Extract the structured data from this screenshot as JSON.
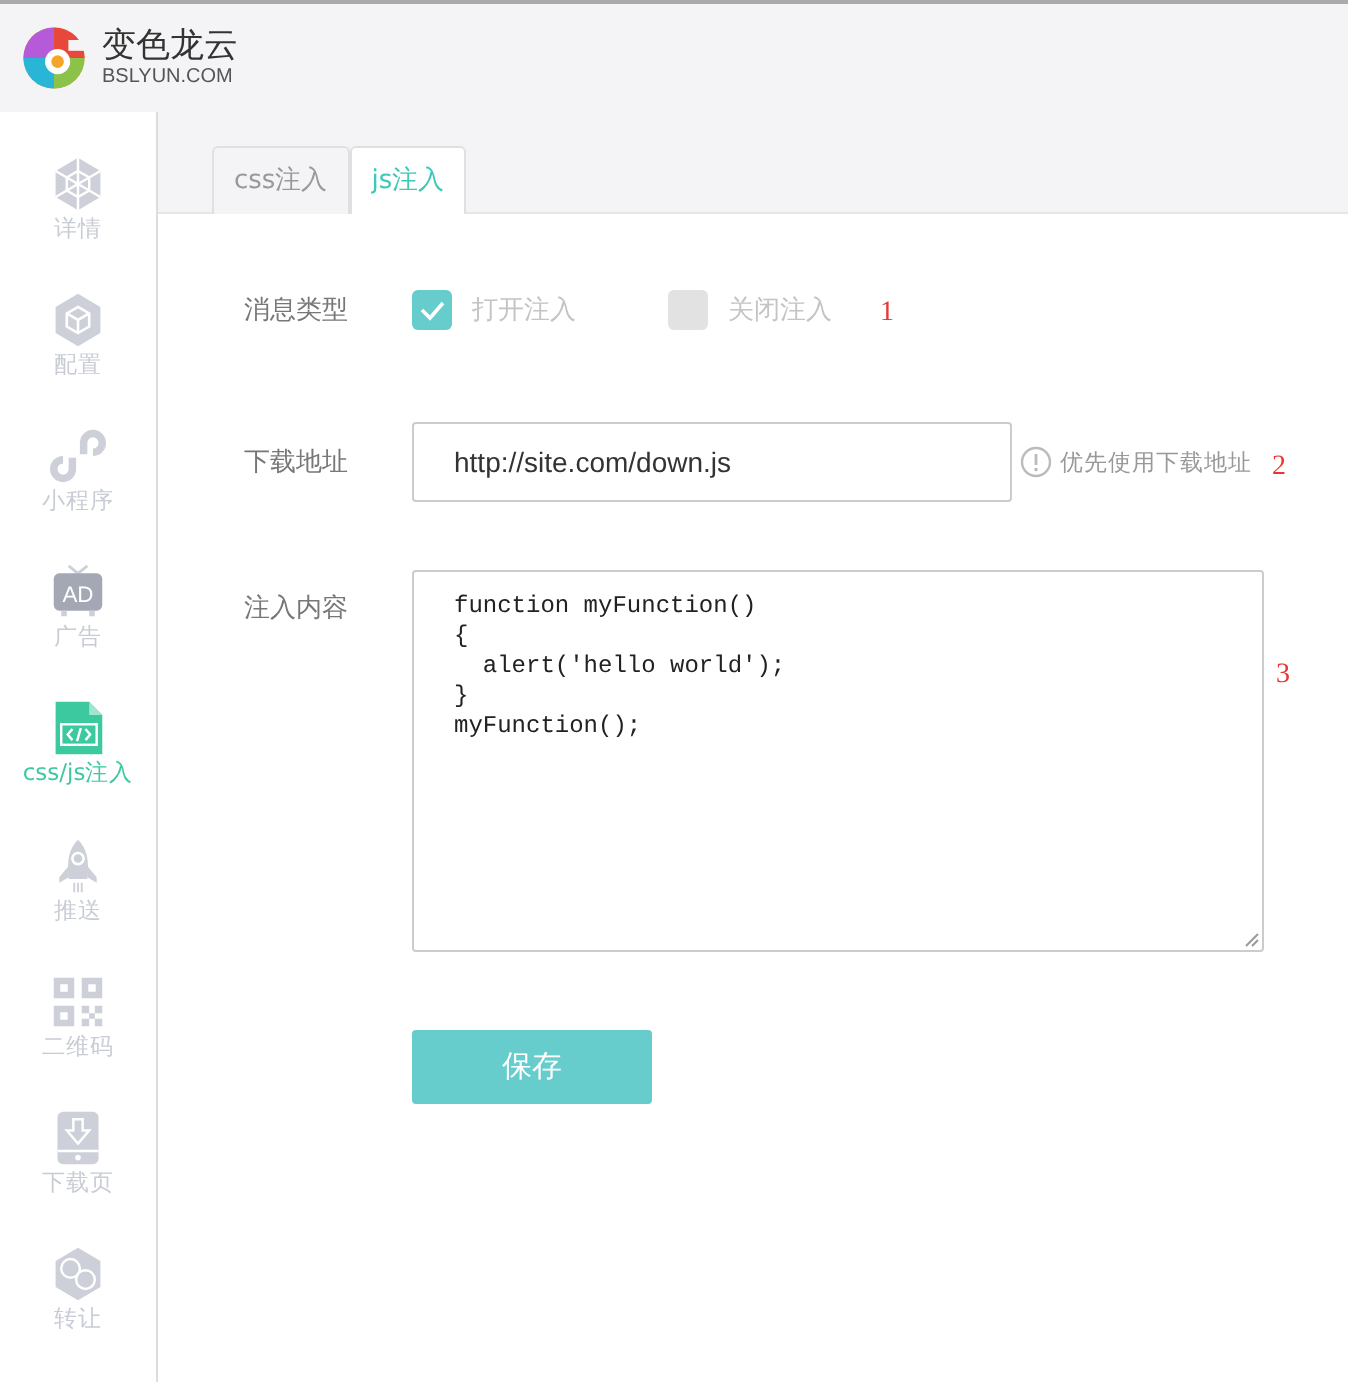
{
  "header": {
    "brand": "变色龙云",
    "domain": "BSLYUN.COM"
  },
  "sidebar": {
    "items": [
      {
        "label": "详情",
        "kind": "detail",
        "selected": false
      },
      {
        "label": "配置",
        "kind": "config",
        "selected": false
      },
      {
        "label": "小程序",
        "kind": "miniapp",
        "selected": false
      },
      {
        "label": "广告",
        "kind": "ad",
        "selected": false,
        "icon_text": "AD"
      },
      {
        "label": "css/js注入",
        "kind": "code",
        "selected": true
      },
      {
        "label": "推送",
        "kind": "rocket",
        "selected": false
      },
      {
        "label": "二维码",
        "kind": "qr",
        "selected": false
      },
      {
        "label": "下载页",
        "kind": "download",
        "selected": false
      },
      {
        "label": "转让",
        "kind": "transfer",
        "selected": false
      }
    ]
  },
  "tabs": [
    {
      "label": "css注入",
      "selected": false
    },
    {
      "label": "js注入",
      "selected": true
    }
  ],
  "form": {
    "message_type": {
      "label": "消息类型",
      "options": [
        {
          "label": "打开注入",
          "checked": true
        },
        {
          "label": "关闭注入",
          "checked": false
        }
      ],
      "note": "1"
    },
    "download_url": {
      "label": "下载地址",
      "value": "http://site.com/down.js",
      "hint": "优先使用下载地址",
      "note": "2"
    },
    "inject_content": {
      "label": "注入内容",
      "lines": [
        "function myFunction()",
        "{",
        "  alert('hello world');",
        "}",
        "myFunction();"
      ],
      "note": "3"
    },
    "save_button": "保存"
  }
}
